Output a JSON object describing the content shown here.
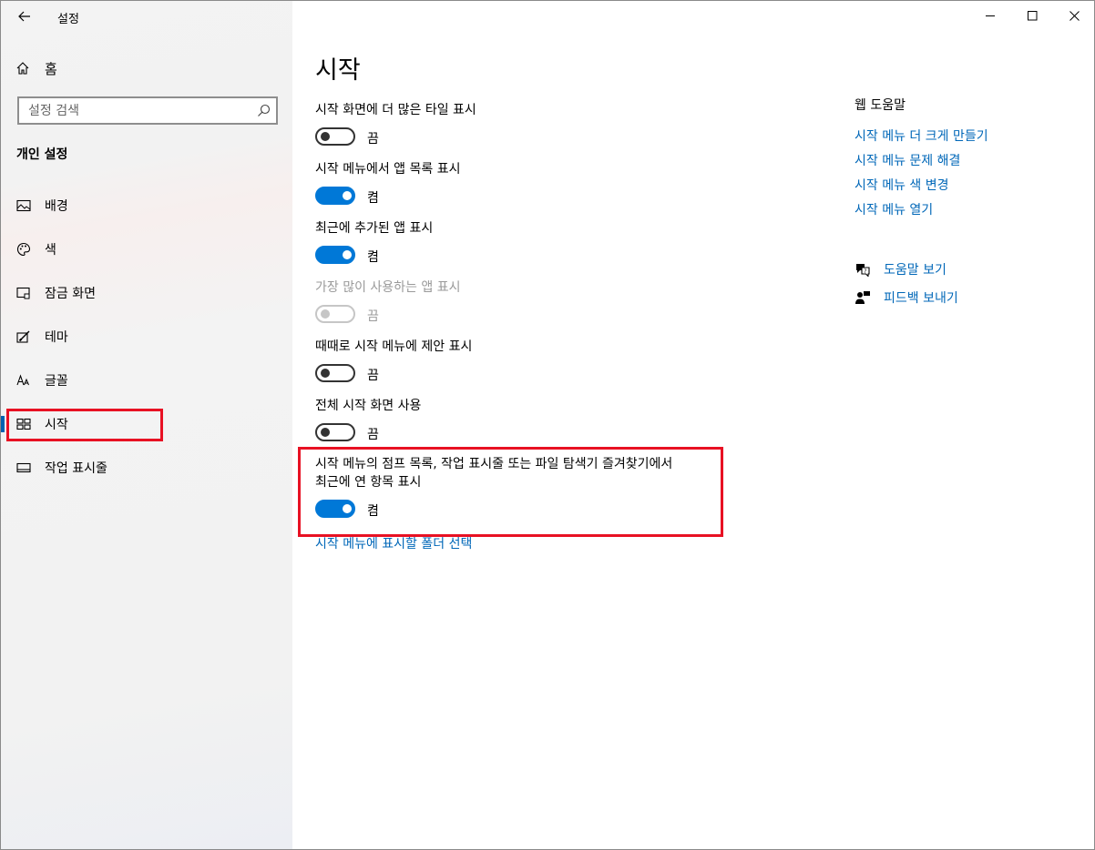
{
  "window": {
    "title": "설정"
  },
  "sidebar": {
    "home_label": "홈",
    "search_placeholder": "설정 검색",
    "section_heading": "개인 설정",
    "items": [
      {
        "label": "배경",
        "icon": "image-icon"
      },
      {
        "label": "색",
        "icon": "palette-icon"
      },
      {
        "label": "잠금 화면",
        "icon": "lock-screen-icon"
      },
      {
        "label": "테마",
        "icon": "theme-brush-icon"
      },
      {
        "label": "글꼴",
        "icon": "font-icon"
      },
      {
        "label": "시작",
        "icon": "start-tiles-icon",
        "selected": true
      },
      {
        "label": "작업 표시줄",
        "icon": "taskbar-icon"
      }
    ]
  },
  "main": {
    "title": "시작",
    "settings": [
      {
        "label": "시작 화면에 더 많은 타일 표시",
        "state": "끔",
        "on": false,
        "disabled": false
      },
      {
        "label": "시작 메뉴에서 앱 목록 표시",
        "state": "켬",
        "on": true,
        "disabled": false
      },
      {
        "label": "최근에 추가된 앱 표시",
        "state": "켬",
        "on": true,
        "disabled": false
      },
      {
        "label": "가장 많이 사용하는 앱 표시",
        "state": "끔",
        "on": false,
        "disabled": true
      },
      {
        "label": "때때로 시작 메뉴에 제안 표시",
        "state": "끔",
        "on": false,
        "disabled": false
      },
      {
        "label": "전체 시작 화면 사용",
        "state": "끔",
        "on": false,
        "disabled": false
      },
      {
        "label_line1": "시작 메뉴의 점프 목록, 작업 표시줄 또는 파일 탐색기 즐겨찾기에서",
        "label_line2": "최근에 연 항목 표시",
        "state": "켬",
        "on": true,
        "disabled": false
      }
    ],
    "folder_link": "시작 메뉴에 표시할 폴더 선택"
  },
  "help": {
    "title": "웹 도움말",
    "links": [
      "시작 메뉴 더 크게 만들기",
      "시작 메뉴 문제 해결",
      "시작 메뉴 색 변경",
      "시작 메뉴 열기"
    ],
    "get_help": "도움말 보기",
    "feedback": "피드백 보내기"
  },
  "colors": {
    "accent": "#0078d7",
    "link": "#0067b8",
    "highlight": "#e81123"
  }
}
